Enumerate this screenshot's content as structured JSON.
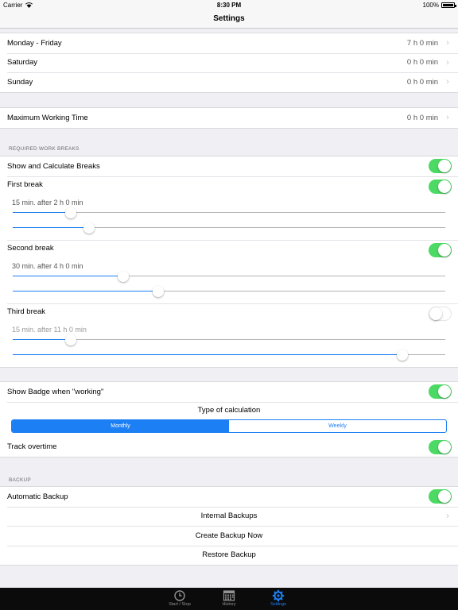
{
  "status_bar": {
    "carrier": "Carrier",
    "time": "8:30 PM",
    "battery": "100%"
  },
  "nav": {
    "title": "Settings"
  },
  "working_hours": [
    {
      "label": "Monday - Friday",
      "value": "7 h 0 min"
    },
    {
      "label": "Saturday",
      "value": "0 h 0 min"
    },
    {
      "label": "Sunday",
      "value": "0 h 0 min"
    }
  ],
  "max_working": {
    "label": "Maximum Working Time",
    "value": "0 h 0 min"
  },
  "breaks": {
    "header": "REQUIRED WORK BREAKS",
    "show_calc": {
      "label": "Show and Calculate Breaks",
      "on": true
    },
    "items": [
      {
        "title": "First break",
        "on": true,
        "desc": "15 min. after 2 h 0 min",
        "slider_duration": 0.135,
        "slider_after": 0.176
      },
      {
        "title": "Second break",
        "on": true,
        "desc": "30 min. after 4 h 0 min",
        "slider_duration": 0.255,
        "slider_after": 0.336
      },
      {
        "title": "Third break",
        "on": false,
        "desc": "15 min. after 11 h 0 min",
        "slider_duration": 0.135,
        "slider_after": 0.9
      }
    ]
  },
  "badge": {
    "label": "Show Badge when \"working\"",
    "on": true
  },
  "calculation": {
    "label": "Type of calculation",
    "options": [
      "Monthly",
      "Weekly"
    ],
    "selected": "Monthly"
  },
  "overtime": {
    "label": "Track overtime",
    "on": true
  },
  "backup": {
    "header": "BACKUP",
    "automatic": {
      "label": "Automatic Backup",
      "on": true
    },
    "internal": "Internal Backups",
    "create": "Create Backup Now",
    "restore": "Restore Backup"
  },
  "tabs": [
    {
      "label": "Start / Stop",
      "icon": "clock-icon",
      "active": false
    },
    {
      "label": "History",
      "icon": "calendar-icon",
      "active": false
    },
    {
      "label": "Settings",
      "icon": "gear-icon",
      "active": true
    }
  ],
  "colors": {
    "accent": "#1d7ff4",
    "toggle_on": "#4cd964",
    "background": "#efeff4"
  }
}
